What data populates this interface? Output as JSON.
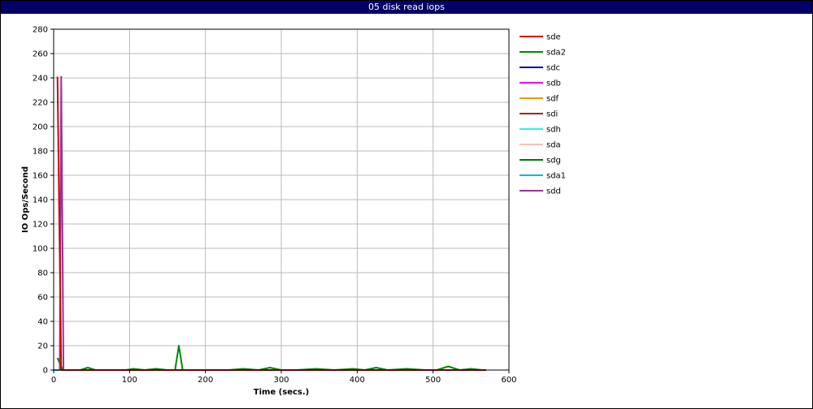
{
  "chart_data": {
    "type": "line",
    "title": "05 disk read iops",
    "xlabel": "Time (secs.)",
    "ylabel": "IO Ops/Second",
    "xlim": [
      0,
      600
    ],
    "ylim": [
      0,
      280
    ],
    "xticks": [
      0,
      100,
      200,
      300,
      400,
      500,
      600
    ],
    "yticks": [
      0,
      20,
      40,
      60,
      80,
      100,
      120,
      140,
      160,
      180,
      200,
      220,
      240,
      260,
      280
    ],
    "grid": true,
    "legend_position": "right",
    "series": [
      {
        "name": "sde",
        "color": "#dd0000",
        "x": [
          5,
          10,
          15,
          20,
          570
        ],
        "y": [
          241,
          0,
          0,
          0,
          0
        ]
      },
      {
        "name": "sda2",
        "color": "#008800",
        "x": [
          5,
          12,
          20,
          35,
          45,
          55,
          65,
          80,
          95,
          105,
          120,
          135,
          150,
          160,
          165,
          170,
          185,
          200,
          230,
          250,
          270,
          285,
          300,
          320,
          345,
          370,
          395,
          410,
          425,
          440,
          465,
          490,
          505,
          520,
          535,
          550,
          565,
          570
        ],
        "y": [
          10,
          0,
          0,
          0,
          2,
          0,
          0,
          0,
          0,
          1,
          0,
          1,
          0,
          0,
          20,
          0,
          0,
          0,
          0,
          1,
          0,
          2,
          0,
          0,
          1,
          0,
          1,
          0,
          2,
          0,
          1,
          0,
          0,
          3,
          0,
          1,
          0,
          0
        ]
      },
      {
        "name": "sdc",
        "color": "#0000aa",
        "x": [
          0,
          570
        ],
        "y": [
          0,
          0
        ]
      },
      {
        "name": "sdb",
        "color": "#ee00ee",
        "x": [
          0,
          570
        ],
        "y": [
          0,
          0
        ]
      },
      {
        "name": "sdf",
        "color": "#ee9900",
        "x": [
          0,
          570
        ],
        "y": [
          0,
          0
        ]
      },
      {
        "name": "sdi",
        "color": "#aa2222",
        "x": [
          0,
          570
        ],
        "y": [
          0,
          0
        ]
      },
      {
        "name": "sdh",
        "color": "#33eeee",
        "x": [
          0,
          570
        ],
        "y": [
          0,
          0
        ]
      },
      {
        "name": "sda",
        "color": "#ffbbbb",
        "x": [
          0,
          570
        ],
        "y": [
          0,
          0
        ]
      },
      {
        "name": "sdg",
        "color": "#007700",
        "x": [
          0,
          570
        ],
        "y": [
          0,
          0
        ]
      },
      {
        "name": "sda1",
        "color": "#00bbcc",
        "x": [
          0,
          570
        ],
        "y": [
          0,
          0
        ]
      },
      {
        "name": "sdd",
        "color": "#993399",
        "x": [
          8,
          10,
          13,
          570
        ],
        "y": [
          0,
          241,
          0,
          0
        ]
      }
    ]
  }
}
